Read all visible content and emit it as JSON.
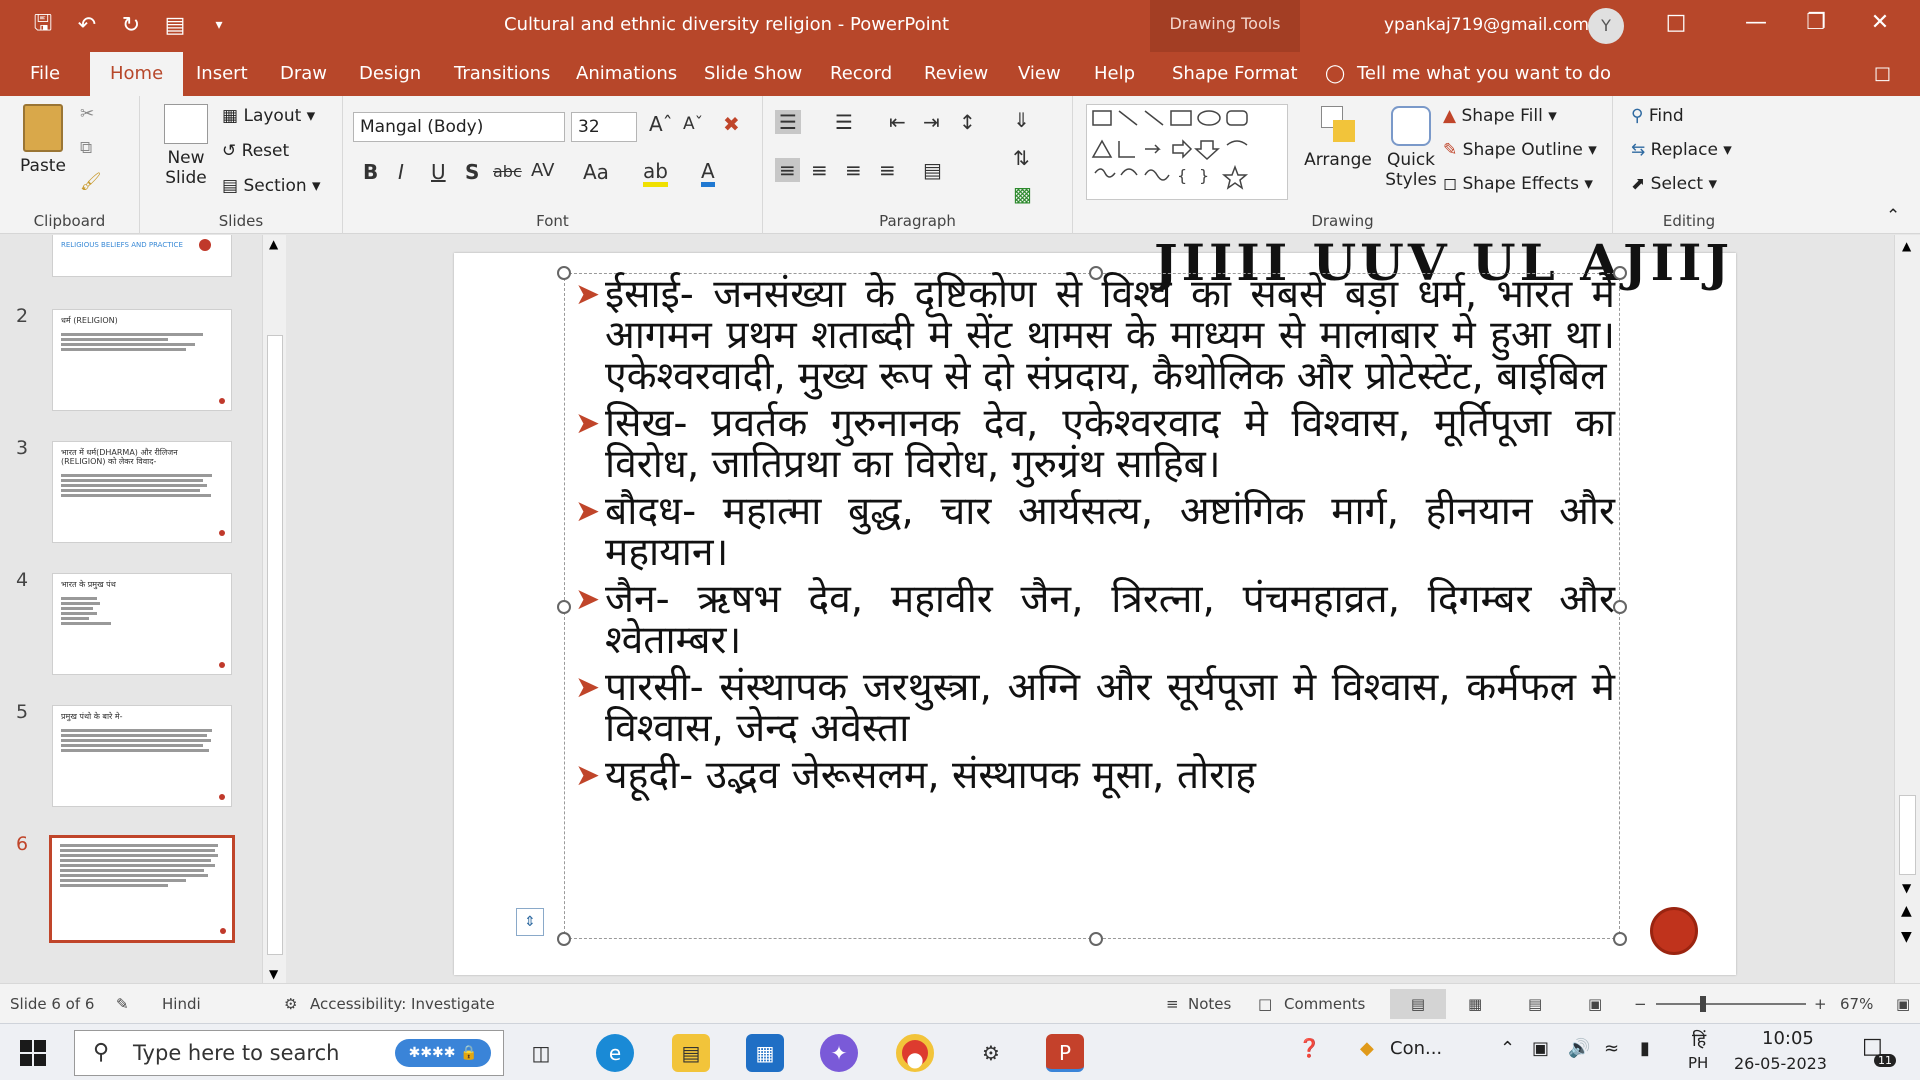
{
  "window": {
    "title": "Cultural and ethnic diversity religion  -  PowerPoint",
    "context_tab": "Drawing Tools",
    "user_email": "ypankaj719@gmail.com",
    "avatar_initial": "Y"
  },
  "tabs": [
    "File",
    "Home",
    "Insert",
    "Draw",
    "Design",
    "Transitions",
    "Animations",
    "Slide Show",
    "Record",
    "Review",
    "View",
    "Help",
    "Shape Format"
  ],
  "tell_me": "Tell me what you want to do",
  "ribbon": {
    "clipboard": {
      "paste": "Paste",
      "label": "Clipboard"
    },
    "slides": {
      "new_slide_1": "New",
      "new_slide_2": "Slide",
      "layout": "Layout",
      "reset": "Reset",
      "section": "Section",
      "label": "Slides"
    },
    "font": {
      "family": "Mangal (Body)",
      "size": "32",
      "label": "Font"
    },
    "paragraph": {
      "label": "Paragraph"
    },
    "drawing": {
      "arrange": "Arrange",
      "quick_styles_1": "Quick",
      "quick_styles_2": "Styles",
      "shape_fill": "Shape Fill",
      "shape_outline": "Shape Outline",
      "shape_effects": "Shape Effects",
      "label": "Drawing"
    },
    "editing": {
      "find": "Find",
      "replace": "Replace",
      "select": "Select",
      "label": "Editing"
    }
  },
  "thumbnails": [
    {
      "num": "",
      "title": "RELIGIOUS BELIEFS AND PRACTICE"
    },
    {
      "num": "2",
      "title": "धर्म (RELIGION)"
    },
    {
      "num": "3",
      "title": "भारत में धर्म(DHARMA) और रीलिजन (RELIGION) को लेकर विवाद-"
    },
    {
      "num": "4",
      "title": "भारत के प्रमुख पंथ"
    },
    {
      "num": "5",
      "title": "प्रमुख पंथो के बारे मे-"
    },
    {
      "num": "6",
      "title": ""
    }
  ],
  "slide": {
    "title_fragment": "JIIII UUV UL AJIIJ",
    "bullets": [
      "ईसाई- जनसंख्या के दृष्टिकोण से विश्व का सबसे बड़ा धर्म, भारत मे आगमन प्रथम शताब्दी मे सेंट थामस के माध्यम से मालाबार मे हुआ था। एकेश्वरवादी, मुख्य रूप से दो संप्रदाय, कैथोलिक और प्रोटेस्टेंट, बाईबिल",
      "सिख- प्रवर्तक गुरुनानक देव, एकेश्वरवाद मे विश्वास, मूर्तिपूजा का विरोध, जातिप्रथा का विरोध, गुरुग्रंथ साहिब।",
      "बौदध- महात्मा बुद्ध, चार आर्यसत्य, अष्टांगिक मार्ग, हीनयान और महायान।",
      "जैन- ऋषभ देव, महावीर जैन, त्रिरत्ना, पंचमहाव्रत, दिगम्बर और श्वेताम्बर।",
      "पारसी- संस्थापक जरथुस्त्रा, अग्नि और सूर्यपूजा मे विश्वास, कर्मफल मे विश्वास, जेन्द अवेस्ता",
      "यहूदी- उद्भव जेरूसलम, संस्थापक मूसा, तोराह"
    ]
  },
  "status": {
    "slide_of": "Slide 6 of 6",
    "language": "Hindi",
    "accessibility": "Accessibility: Investigate",
    "notes": "Notes",
    "comments": "Comments",
    "zoom": "67%"
  },
  "taskbar": {
    "search_placeholder": "Type here to search",
    "tray_app": "Con...",
    "ime_lang": "हिं",
    "ime_mode": "PH",
    "time": "10:05",
    "date": "26-05-2023",
    "notif_count": "11"
  }
}
